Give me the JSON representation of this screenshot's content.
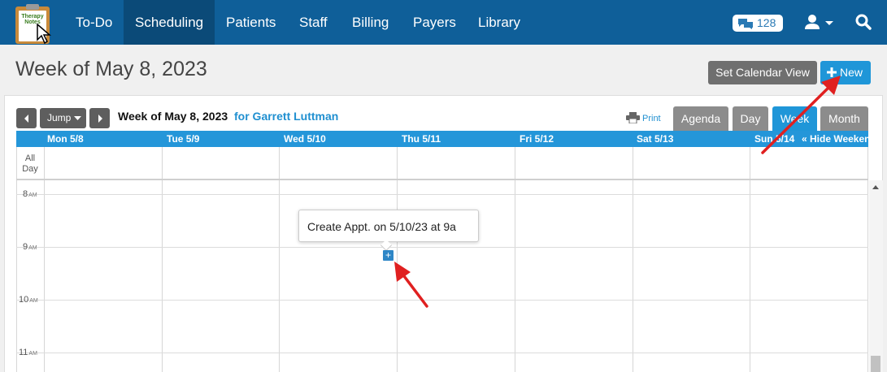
{
  "logo": {
    "line1": "Therapy",
    "line2": "Notes"
  },
  "nav": {
    "items": [
      "To-Do",
      "Scheduling",
      "Patients",
      "Staff",
      "Billing",
      "Payers",
      "Library"
    ],
    "message_count": "128"
  },
  "page": {
    "title": "Week of May 8, 2023",
    "set_calendar_view": "Set Calendar View",
    "new_button": "New"
  },
  "calendar": {
    "jump_label": "Jump",
    "week_title": "Week of May 8, 2023",
    "for_name": "for Garrett Luttman",
    "print_label": "Print",
    "views": [
      "Agenda",
      "Day",
      "Week",
      "Month"
    ],
    "active_view": "Week",
    "days": [
      "Mon 5/8",
      "Tue 5/9",
      "Wed 5/10",
      "Thu 5/11",
      "Fri 5/12",
      "Sat 5/13",
      "Sun 5/14"
    ],
    "hide_weekend": "« Hide Weekend",
    "allday_line1": "All",
    "allday_line2": "Day",
    "hours": [
      {
        "num": "8",
        "ampm": "AM"
      },
      {
        "num": "9",
        "ampm": "AM"
      },
      {
        "num": "10",
        "ampm": "AM"
      },
      {
        "num": "11",
        "ampm": "AM"
      }
    ],
    "tooltip": "Create Appt. on 5/10/23 at 9a",
    "add_symbol": "+"
  },
  "colors": {
    "nav_bg": "#0f5f99",
    "accent": "#1f96d8",
    "annotation_arrow": "#e02020"
  }
}
